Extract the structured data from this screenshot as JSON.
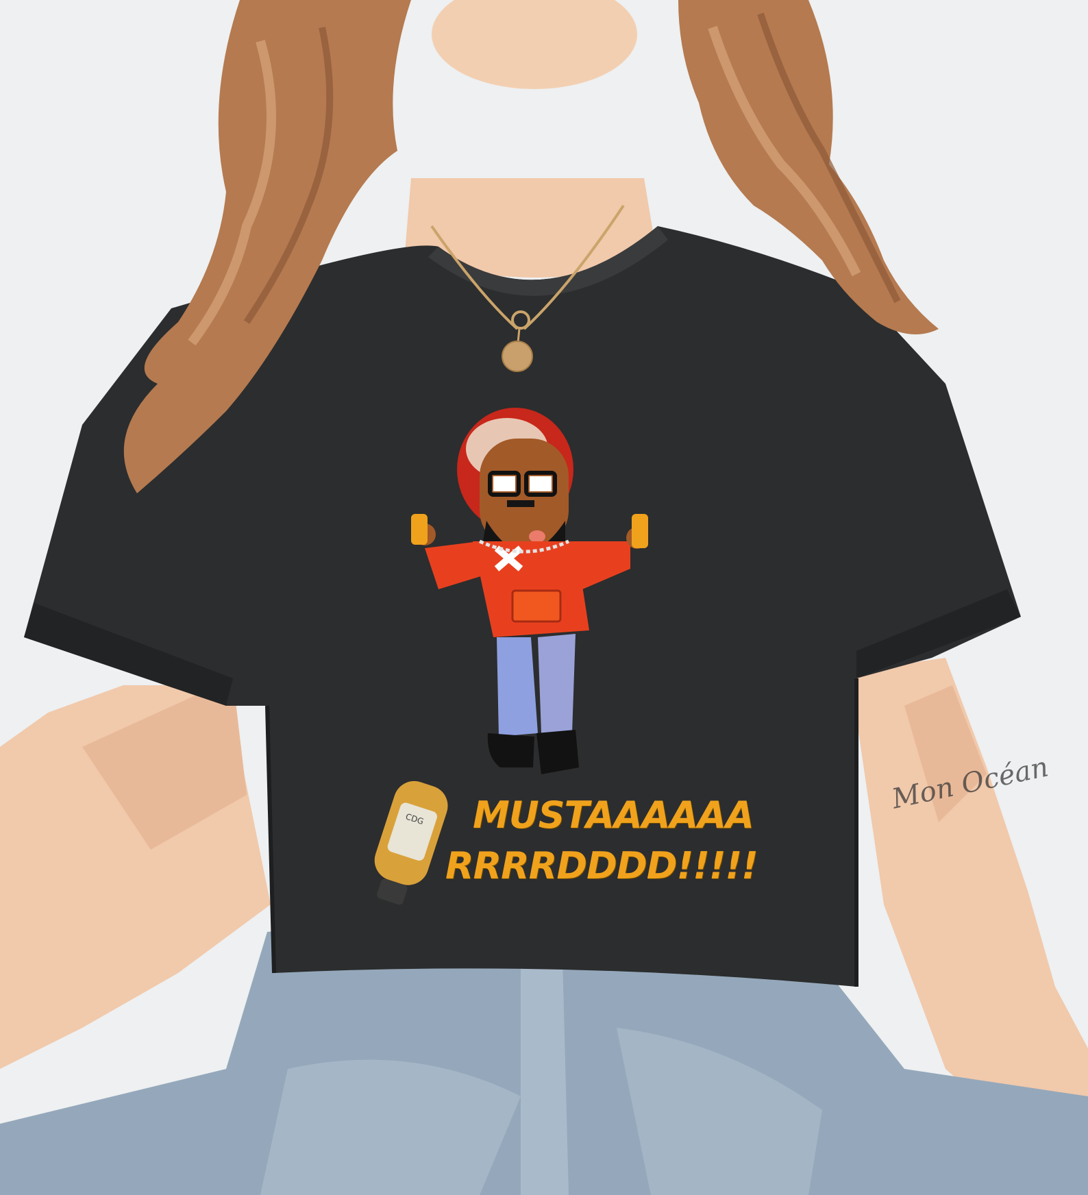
{
  "print": {
    "line1": "MUSTAAAAAA",
    "line2": "RRRRDDDD!!!!!"
  },
  "tattoo": {
    "text": "Mon Océan"
  },
  "bottle_label": {
    "text": "CDG"
  },
  "colors": {
    "background": "#eef0f1",
    "shirt": "#2b2c2d",
    "hair": "#b67a4e",
    "skin": "#f0c6a7",
    "jeans": "#8fa2b6",
    "print_text": "#f0a21c",
    "hoodie": "#e8401f",
    "character_pants": "#8ea0df"
  }
}
